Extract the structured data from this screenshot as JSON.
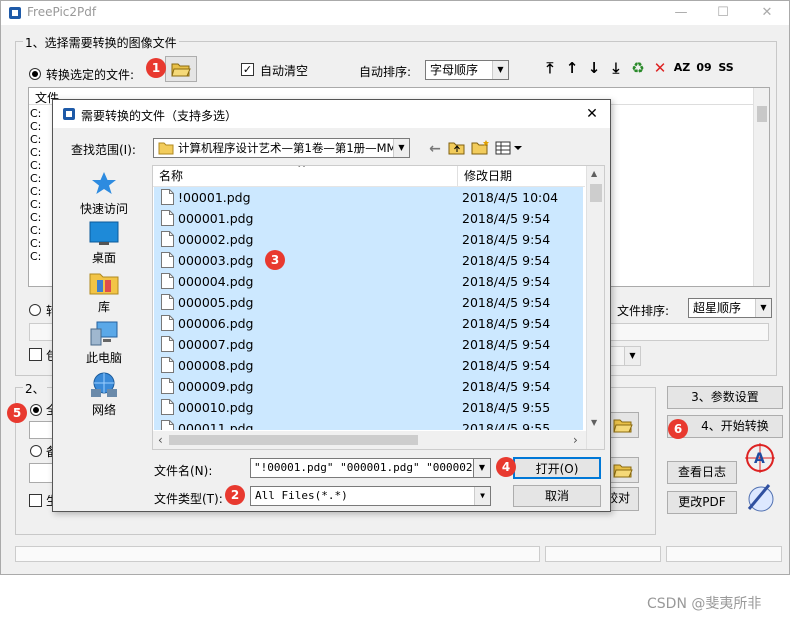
{
  "app": {
    "title": "FreePic2Pdf",
    "group1_label": "1、选择需要转换的图像文件",
    "radio_selected_files": "转换选定的文件:",
    "auto_clear": "自动清空",
    "auto_sort_label": "自动排序:",
    "auto_sort_value": "字母顺序",
    "file_col": "文件",
    "file_rows": [
      "C:",
      "C:",
      "C:",
      "C:",
      "C:",
      "C:",
      "C:",
      "C:",
      "C:",
      "C:",
      "C:",
      "C:"
    ],
    "file_sort_label": "文件排序:",
    "file_sort_value": "超星顺序",
    "group2_label": "2、",
    "btn_params": "3、参数设置",
    "btn_start": "4、开始转换",
    "btn_log": "查看日志",
    "btn_change_pdf": "更改PDF",
    "partial_labels": {
      "r2": "转",
      "c1": "包",
      "r3": "全",
      "r4": "备",
      "c2": "生",
      "compare": "较对"
    }
  },
  "dialog": {
    "title": "需要转换的文件（支持多选）",
    "lookin_label": "查找范围(I):",
    "lookin_value": "计算机程序设计艺术—第1卷—第1册—MM",
    "nav": [
      "快速访问",
      "桌面",
      "库",
      "此电脑",
      "网络"
    ],
    "col_name": "名称",
    "col_modified": "修改日期",
    "files": [
      {
        "name": "!00001.pdg",
        "date": "2018/4/5 10:04"
      },
      {
        "name": "000001.pdg",
        "date": "2018/4/5 9:54"
      },
      {
        "name": "000002.pdg",
        "date": "2018/4/5 9:54"
      },
      {
        "name": "000003.pdg",
        "date": "2018/4/5 9:54"
      },
      {
        "name": "000004.pdg",
        "date": "2018/4/5 9:54"
      },
      {
        "name": "000005.pdg",
        "date": "2018/4/5 9:54"
      },
      {
        "name": "000006.pdg",
        "date": "2018/4/5 9:54"
      },
      {
        "name": "000007.pdg",
        "date": "2018/4/5 9:54"
      },
      {
        "name": "000008.pdg",
        "date": "2018/4/5 9:54"
      },
      {
        "name": "000009.pdg",
        "date": "2018/4/5 9:54"
      },
      {
        "name": "000010.pdg",
        "date": "2018/4/5 9:55"
      },
      {
        "name": "000011.pdg",
        "date": "2018/4/5 9:55"
      }
    ],
    "filename_label": "文件名(N):",
    "filename_value": "\"!00001.pdg\" \"000001.pdg\" \"000002.pdg",
    "filetype_label": "文件类型(T):",
    "filetype_value": "All Files(*.*)",
    "open_button": "打开(O)",
    "cancel_button": "取消"
  },
  "annotations": [
    "1",
    "2",
    "3",
    "4",
    "5",
    "6"
  ],
  "watermark": "CSDN @斐夷所非",
  "colors": {
    "badge": "#e8392f",
    "selection": "#cce8ff"
  }
}
